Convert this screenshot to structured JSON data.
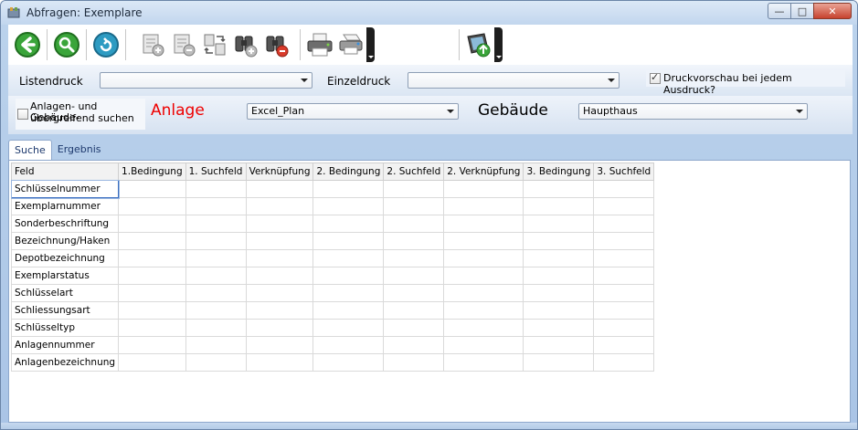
{
  "window": {
    "title": "Abfragen: Exemplare"
  },
  "toolbar": {
    "buttons": [
      {
        "name": "back-icon"
      },
      {
        "name": "search-icon"
      },
      {
        "name": "refresh-icon"
      },
      {
        "name": "add-document-icon"
      },
      {
        "name": "remove-document-icon"
      },
      {
        "name": "transfer-icon"
      },
      {
        "name": "binoculars-add-icon"
      },
      {
        "name": "binoculars-remove-icon"
      },
      {
        "name": "printer-icon"
      },
      {
        "name": "printer-settings-icon"
      },
      {
        "name": "export-icon"
      }
    ]
  },
  "print": {
    "listendruck_label": "Listendruck",
    "listendruck_value": "",
    "einzeldruck_label": "Einzeldruck",
    "einzeldruck_value": "",
    "preview_label": "Druckvorschau bei jedem Ausdruck?",
    "preview_checked": true
  },
  "filter": {
    "global_search_label": "Anlagen- und Gebäude-übergreifend suchen",
    "global_search_line1": "Anlagen- und Gebäude-",
    "global_search_line2": "übergreifend suchen",
    "anlage_label": "Anlage",
    "anlage_value": "Excel_Plan",
    "gebaeude_label": "Gebäude",
    "gebaeude_value": "Haupthaus"
  },
  "tabs": [
    {
      "label": "Suche",
      "active": true
    },
    {
      "label": "Ergebnis",
      "active": false
    }
  ],
  "grid": {
    "columns": [
      "Feld",
      "1.Bedingung",
      "1. Suchfeld",
      "Verknüpfung",
      "2. Bedingung",
      "2. Suchfeld",
      "2. Verknüpfung",
      "3. Bedingung",
      "3. Suchfeld"
    ],
    "rows": [
      "Schlüsselnummer",
      "Exemplarnummer",
      "Sonderbeschriftung",
      "Bezeichnung/Haken",
      "Depotbezeichnung",
      "Exemplarstatus",
      "Schlüsselart",
      "Schliessungsart",
      "Schlüsseltyp",
      "Anlagennummer",
      "Anlagenbezeichnung"
    ],
    "selected_row": 0
  },
  "colors": {
    "anlage_label": "#ee0000",
    "accent": "#3c6fc1"
  }
}
